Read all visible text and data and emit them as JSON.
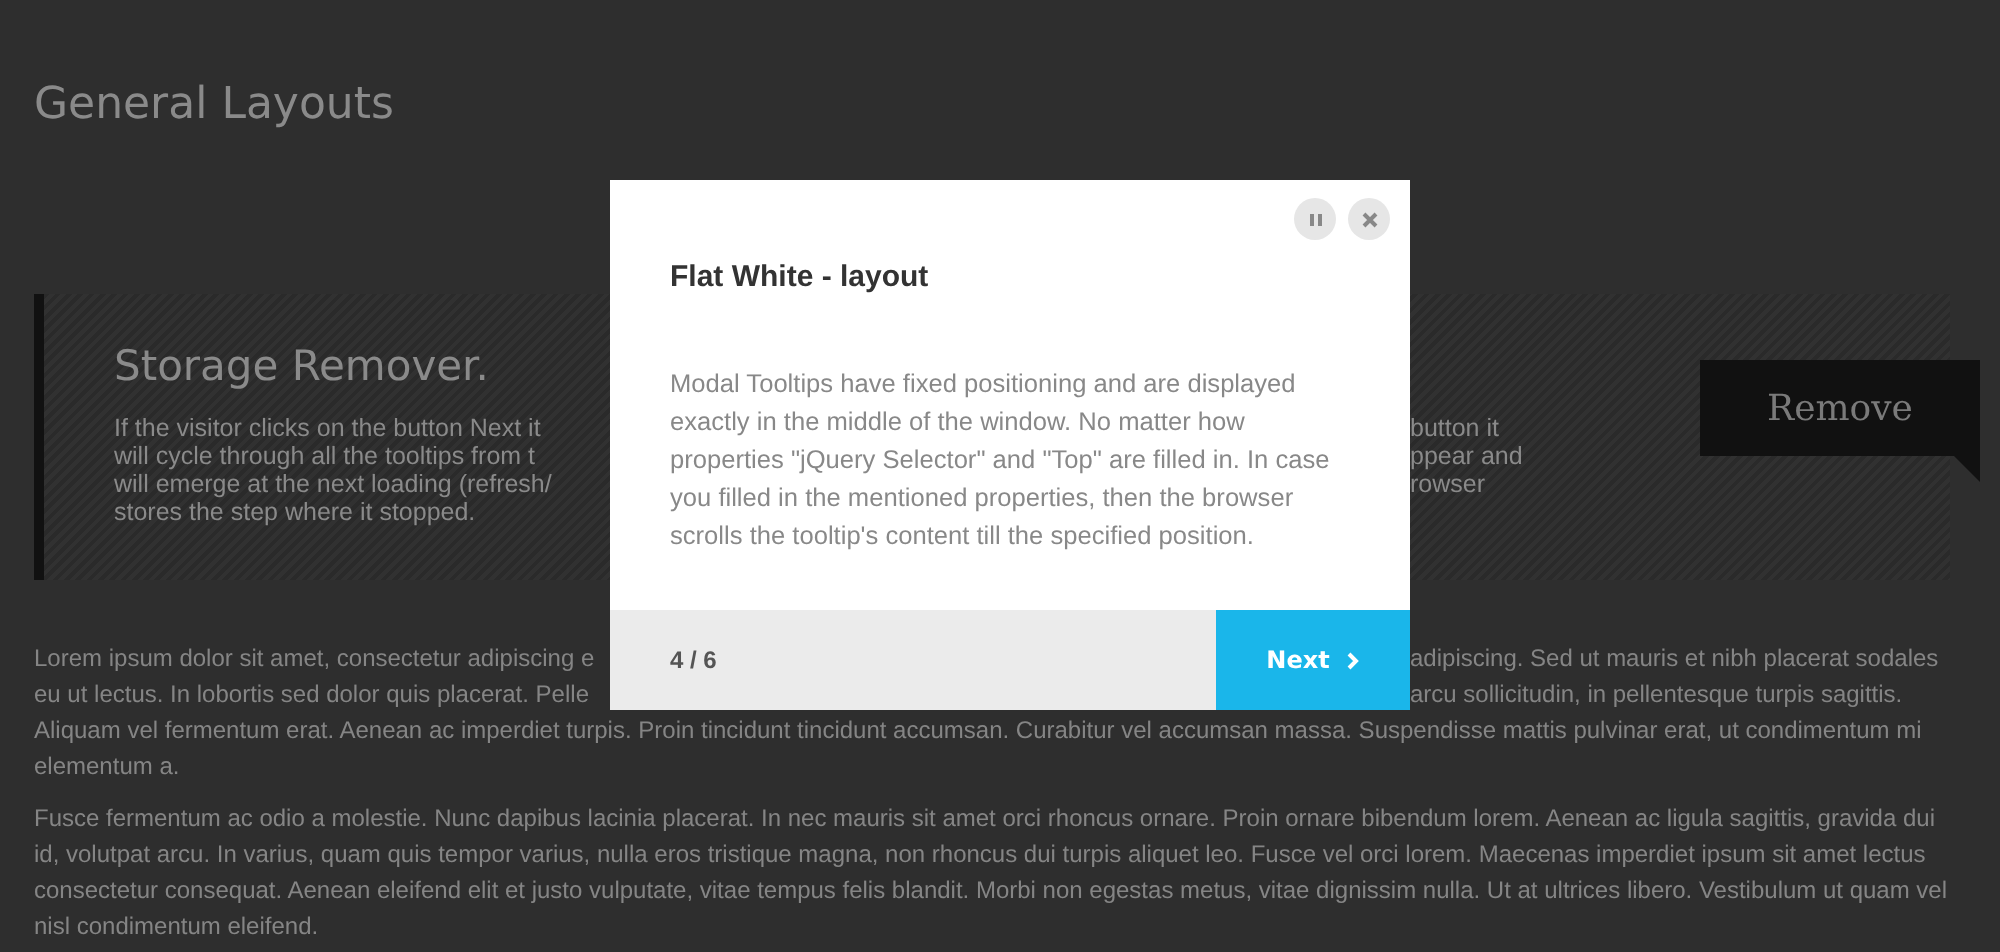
{
  "page": {
    "title": "General Layouts"
  },
  "storage_panel": {
    "title": "Storage Remover.",
    "description_lines": [
      {
        "left": "If the visitor clicks on the button Next it",
        "right": "button it"
      },
      {
        "left": "will cycle through all the tooltips from t",
        "right": "ppear and"
      },
      {
        "left": "will emerge at the next loading (refresh/",
        "right": "rowser"
      },
      {
        "left": "stores the step where it stopped."
      }
    ],
    "remove_button": "Remove"
  },
  "content": {
    "paragraph_1_lines": [
      {
        "left": "Lorem ipsum dolor sit amet, consectetur adipiscing e",
        "right": "adipiscing. Sed ut mauris et nibh placerat sodales"
      },
      {
        "left": "eu ut lectus. In lobortis sed dolor quis placerat. Pelle",
        "right": "arcu sollicitudin, in pellentesque turpis sagittis."
      },
      {
        "left": "Aliquam vel fermentum erat. Aenean ac imperdiet turpis. Proin tincidunt tincidunt accumsan. Curabitur vel accumsan massa. Suspendisse mattis pulvinar erat, ut condimentum mi"
      },
      {
        "left": "elementum a."
      }
    ],
    "paragraph_2": "Fusce fermentum ac odio a molestie. Nunc dapibus lacinia placerat. In nec mauris sit amet orci rhoncus ornare. Proin ornare bibendum lorem. Aenean ac ligula sagittis, gravida dui id, volutpat arcu. In varius, quam quis tempor varius, nulla eros tristique magna, non rhoncus dui turpis aliquet leo. Fusce vel orci lorem. Maecenas imperdiet ipsum sit amet lectus consectetur consequat. Aenean eleifend elit et justo vulputate, vitae tempus felis blandit. Morbi non egestas metus, vitae dignissim nulla. Ut at ultrices libero. Vestibulum ut quam vel nisl condimentum eleifend."
  },
  "tooltip": {
    "title": "Flat White - layout",
    "body": "Modal Tooltips have fixed positioning and are displayed exactly in the middle of the window. No matter how properties \"jQuery Selector\" and \"Top\" are filled in. In case you filled in the mentioned properties, then the browser scrolls the tooltip's content till the specified position.",
    "counter": "4 / 6",
    "next_button": "Next"
  }
}
